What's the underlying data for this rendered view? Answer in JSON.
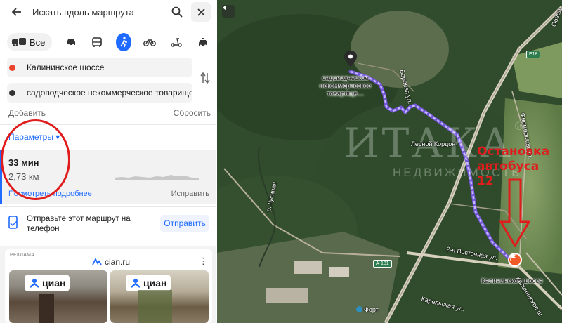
{
  "search": {
    "placeholder": "Искать вдоль маршрута"
  },
  "modes": {
    "all_label": "Все",
    "active": "walk"
  },
  "route_points": {
    "from": "Калининское шоссе",
    "to": "садоводческое некоммерческое товарищест…"
  },
  "actions": {
    "add": "Добавить",
    "reset": "Сбросить"
  },
  "params_label": "Параметры ▾",
  "route": {
    "time": "33 мин",
    "distance": "2,73 км",
    "details": "Посмотреть подробнее",
    "fix": "Исправить"
  },
  "send": {
    "text": "Отправьте этот маршрут на телефон",
    "button": "Отправить"
  },
  "ad": {
    "label": "РЕКЛАМА",
    "brand": "cian.ru",
    "badge": "циан"
  },
  "map": {
    "destination_label_1": "садоводческое",
    "destination_label_2": "некоммерческое",
    "destination_label_3": "товарище…",
    "start_label": "Калининское шоссе",
    "place_lesnoy": "Лесной Кордон",
    "place_fort": "Форт",
    "street_borovaya": "Боровая ул.",
    "street_vostochnaya": "2-я Восточная ул.",
    "street_fermerskaya": "Фермерская ул.",
    "street_karelskaya": "Карельская ул.",
    "street_kalininskoe": "Калининское ш.",
    "river": "р. Гусиная",
    "road_a181": "А-181",
    "road_e18": "E18",
    "road_obv": "Обвод",
    "annotation_line1": "Остановка",
    "annotation_line2": "автобуса",
    "annotation_line3": "12",
    "watermark": "ИТАКА",
    "watermark_sub": "НЕДВИЖИМОСТЬ",
    "watermark_mark": "®"
  },
  "colors": {
    "accent": "#1f6bff",
    "route_line": "#a98cff",
    "annotation": "#e01c1c",
    "start_marker": "#f25a2a"
  }
}
